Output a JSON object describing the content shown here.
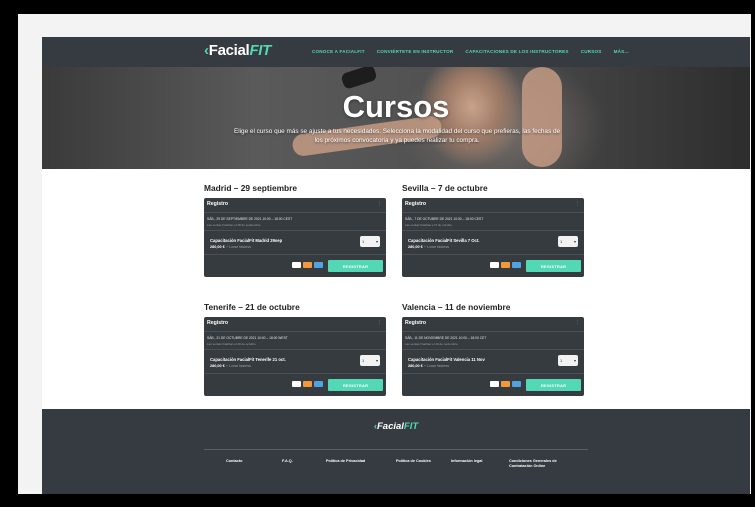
{
  "header": {
    "logo_main": "Facial",
    "logo_accent": "FIT",
    "nav": [
      "CONOCE A FACIALFIT",
      "CONVIÉRTETE EN INSTRUCTOR",
      "CAPACITACIONES DE LOS INSTRUCTORES",
      "CURSOS",
      "MÁS..."
    ]
  },
  "hero": {
    "title": "Cursos",
    "text": "Elige el curso que más se ajuste a tus necesidades. Selecciona la modalidad del curso que prefieras, las fechas de los próximos convocatoria y ya puedes realizar tu compra."
  },
  "events": [
    {
      "heading": "Madrid – 29 septiembre",
      "register_label": "Registro",
      "date_line": "SÁB., 29 DE SEPTIEMBRE DE 2021 10:00 – 18:00 CEST",
      "note": "Las ventas finalizan el 28 de septiembre",
      "ticket": "Capacitación FacialFit Madrid 29sep",
      "price": "280,00 €",
      "tax": "+ Lowe fasless",
      "qty": "1",
      "button": "REGISTRAR"
    },
    {
      "heading": "Sevilla – 7 de octubre",
      "register_label": "Registro",
      "date_line": "SÁB., 7 DE OCTUBRE DE 2021 10:00 – 18:00 CEST",
      "note": "Las ventas finalizan el 6 de octubre",
      "ticket": "Capacitación FacialFit Sevilla 7 Oct.",
      "price": "280,00 €",
      "tax": "+ Lowe fasless",
      "qty": "1",
      "button": "REGISTRAR"
    },
    {
      "heading": "Tenerife – 21 de octubre",
      "register_label": "Registro",
      "date_line": "SÁB., 21 DE OCTUBRE DE 2021 10:00 – 18:00 WEST",
      "note": "Las ventas finalizan el 20 de octubre",
      "ticket": "Capacitación FacialFit Tenerife 21 oct.",
      "price": "280,00 €",
      "tax": "+ Lowe fasless",
      "qty": "1",
      "button": "REGISTRAR"
    },
    {
      "heading": "Valencia – 11 de noviembre",
      "register_label": "Registro",
      "date_line": "SÁB., 11 DE NOVIEMBRE DE 2021 10:00 – 18:00 CET",
      "note": "Las ventas finalizan el 10 de noviembre",
      "ticket": "Capacitación FacialFit Valencia 11 Nov",
      "price": "280,00 €",
      "tax": "+ Lowe fasless",
      "qty": "1",
      "button": "REGISTRAR"
    }
  ],
  "footer": {
    "logo_main": "Facial",
    "logo_accent": "FIT",
    "links": [
      "Contacto",
      "F.A.Q.",
      "Política de Privacidad",
      "Política de Cookies",
      "Información legal",
      "Condiciones Generales de Contratación Online"
    ]
  },
  "colors": {
    "accent": "#52d8b4",
    "header_bg": "#353b40",
    "card_bg": "#363b40"
  },
  "icons": [
    "leaf-logo-icon",
    "info-icon",
    "chevron-down-icon",
    "visa-icon",
    "mastercard-icon",
    "amex-icon"
  ]
}
